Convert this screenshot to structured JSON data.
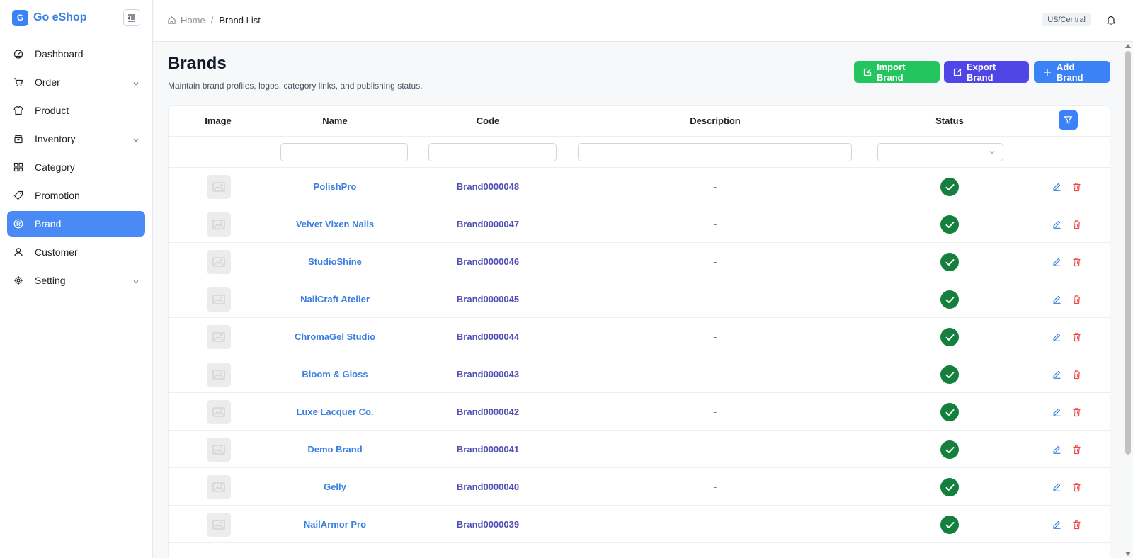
{
  "app": {
    "logo_letter": "G",
    "name": "Go eShop"
  },
  "sidebar": {
    "items": [
      {
        "label": "Dashboard",
        "icon": "dashboard-icon",
        "has_children": false,
        "active": false
      },
      {
        "label": "Order",
        "icon": "cart-icon",
        "has_children": true,
        "active": false
      },
      {
        "label": "Product",
        "icon": "shirt-icon",
        "has_children": false,
        "active": false
      },
      {
        "label": "Inventory",
        "icon": "box-icon",
        "has_children": true,
        "active": false
      },
      {
        "label": "Category",
        "icon": "grid-icon",
        "has_children": false,
        "active": false
      },
      {
        "label": "Promotion",
        "icon": "tag-icon",
        "has_children": false,
        "active": false
      },
      {
        "label": "Brand",
        "icon": "registered-icon",
        "has_children": false,
        "active": true
      },
      {
        "label": "Customer",
        "icon": "user-icon",
        "has_children": false,
        "active": false
      },
      {
        "label": "Setting",
        "icon": "gear-icon",
        "has_children": true,
        "active": false
      }
    ]
  },
  "header": {
    "breadcrumb": {
      "home": "Home",
      "separator": "/",
      "current": "Brand List"
    },
    "timezone": "US/Central"
  },
  "page": {
    "title": "Brands",
    "subtitle": "Maintain brand profiles, logos, category links, and publishing status.",
    "buttons": {
      "import": "Import Brand",
      "export": "Export Brand",
      "add": "Add Brand"
    }
  },
  "table": {
    "columns": {
      "image": "Image",
      "name": "Name",
      "code": "Code",
      "description": "Description",
      "status": "Status"
    },
    "rows": [
      {
        "name": "PolishPro",
        "code": "Brand0000048",
        "description": "-",
        "status": "active"
      },
      {
        "name": "Velvet Vixen Nails",
        "code": "Brand0000047",
        "description": "-",
        "status": "active"
      },
      {
        "name": "StudioShine",
        "code": "Brand0000046",
        "description": "-",
        "status": "active"
      },
      {
        "name": "NailCraft Atelier",
        "code": "Brand0000045",
        "description": "-",
        "status": "active"
      },
      {
        "name": "ChromaGel Studio",
        "code": "Brand0000044",
        "description": "-",
        "status": "active"
      },
      {
        "name": "Bloom & Gloss",
        "code": "Brand0000043",
        "description": "-",
        "status": "active"
      },
      {
        "name": "Luxe Lacquer Co.",
        "code": "Brand0000042",
        "description": "-",
        "status": "active"
      },
      {
        "name": "Demo Brand",
        "code": "Brand0000041",
        "description": "-",
        "status": "active"
      },
      {
        "name": "Gelly",
        "code": "Brand0000040",
        "description": "-",
        "status": "active"
      },
      {
        "name": "NailArmor Pro",
        "code": "Brand0000039",
        "description": "-",
        "status": "active"
      }
    ]
  },
  "colors": {
    "primary": "#3b82f6",
    "import": "#22c55e",
    "export": "#4f46e5",
    "status_ok": "#15803d",
    "delete": "#ef4444"
  }
}
